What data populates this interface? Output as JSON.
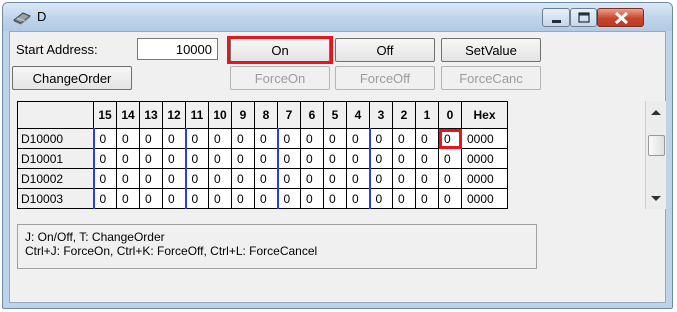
{
  "window": {
    "title": "D",
    "icon": "device-chip-icon"
  },
  "titlebar_buttons": [
    "minimize-icon",
    "maximize-icon",
    "close-icon"
  ],
  "controls": {
    "start_address_label": "Start Address:",
    "start_address_value": "10000",
    "on_button": "On",
    "off_button": "Off",
    "setvalue_button": "SetValue",
    "changeorder_button": "ChangeOrder",
    "forceon_button": "ForceOn",
    "forceoff_button": "ForceOff",
    "forcecanc_button": "ForceCanc"
  },
  "grid": {
    "columns": [
      "",
      "15",
      "14",
      "13",
      "12",
      "11",
      "10",
      "9",
      "8",
      "7",
      "6",
      "5",
      "4",
      "3",
      "2",
      "1",
      "0",
      "Hex"
    ],
    "rows": [
      {
        "address": "D10000",
        "bits": [
          "0",
          "0",
          "0",
          "0",
          "0",
          "0",
          "0",
          "0",
          "0",
          "0",
          "0",
          "0",
          "0",
          "0",
          "0",
          "0"
        ],
        "hex": "0000"
      },
      {
        "address": "D10001",
        "bits": [
          "0",
          "0",
          "0",
          "0",
          "0",
          "0",
          "0",
          "0",
          "0",
          "0",
          "0",
          "0",
          "0",
          "0",
          "0",
          "0"
        ],
        "hex": "0000"
      },
      {
        "address": "D10002",
        "bits": [
          "0",
          "0",
          "0",
          "0",
          "0",
          "0",
          "0",
          "0",
          "0",
          "0",
          "0",
          "0",
          "0",
          "0",
          "0",
          "0"
        ],
        "hex": "0000"
      },
      {
        "address": "D10003",
        "bits": [
          "0",
          "0",
          "0",
          "0",
          "0",
          "0",
          "0",
          "0",
          "0",
          "0",
          "0",
          "0",
          "0",
          "0",
          "0",
          "0"
        ],
        "hex": "0000"
      }
    ]
  },
  "help": {
    "line1": "J: On/Off,   T: ChangeOrder",
    "line2": "Ctrl+J: ForceOn,   Ctrl+K: ForceOff,   Ctrl+L: ForceCancel"
  },
  "highlight_color": "#e8141e"
}
